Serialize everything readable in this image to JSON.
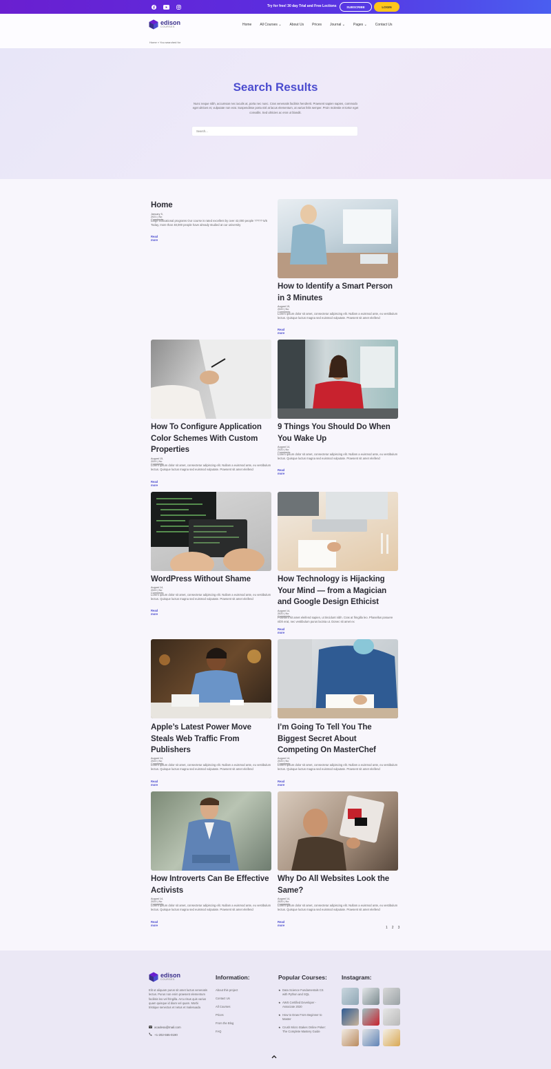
{
  "topbar": {
    "promo": "Try for free! 30 day Trial and Free Lections",
    "subscribe_label": "SUBSCRIBE",
    "login_label": "LOGIN",
    "social_icons": [
      "facebook-icon",
      "youtube-icon",
      "instagram-icon"
    ]
  },
  "header": {
    "logo_name": "edison",
    "logo_sub": "COURSES",
    "nav": [
      "Home",
      "All Courses",
      "About Us",
      "Prices",
      "Journal",
      "Pages",
      "Contact Us"
    ],
    "nav_dropdowns": [
      "All Courses",
      "Journal",
      "Pages"
    ],
    "breadcrumb": "Home » You searched for"
  },
  "hero": {
    "title": "Search Results",
    "text": "Nunc neque nibh, accumsan nec iaculis at, porta nec nunc. Cras venenatis facilisis hendrerit. Praesent sapien sapien, commodo eget ultrices et, vulputate non erat. Suspendisse porta nisl at lacus elementum, at varius felis semper. Proin molestie et tortor eget convallis. Sed ultricies ac eros ut blandit.",
    "search_placeholder": "Search..."
  },
  "posts": [
    {
      "title": "Home",
      "meta": "January 5, 2021 | No Comments",
      "excerpt": "Large educational programs Our course is rated excellent by over 42,000 people ????? 5/5 Today, more than 48,000 people have already studied at our university",
      "more": "Read more"
    },
    {
      "title": "How to Identify a Smart Person in 3 Minutes",
      "meta": "August 15, 2020 | No Comments",
      "excerpt": "Lorem ipsum dolor sit amet, consectetur adipiscing elit. Nullam a euismod ante, eu vestibulum lectus. Quisque luctus magna sed euismod vulputate. Praesent sit amet eleifend",
      "more": "Read more"
    },
    {
      "title": "How To Configure Application Color Schemes With Custom Properties",
      "meta": "August 15, 2020 | No Comments",
      "excerpt": "Lorem ipsum dolor sit amet, consectetur adipiscing elit. Nullam a euismod ante, eu vestibulum lectus. Quisque luctus magna sed euismod vulputate. Praesent sit amet eleifend",
      "more": "Read more"
    },
    {
      "title": "9 Things You Should Do When You Wake Up",
      "meta": "August 14, 2020 | No Comments",
      "excerpt": "Lorem ipsum dolor sit amet, consectetur adipiscing elit. Nullam a euismod ante, eu vestibulum lectus. Quisque luctus magna sed euismod vulputate. Praesent sit amet eleifend",
      "more": "Read more"
    },
    {
      "title": "WordPress Without Shame",
      "meta": "August 14, 2020 | No Comments",
      "excerpt": "Lorem ipsum dolor sit amet, consectetur adipiscing elit. Nullam a euismod ante, eu vestibulum lectus. Quisque luctus magna sed euismod vulputate. Praesent sit amet eleifend",
      "more": "Read more"
    },
    {
      "title": "How Technology is Hijacking Your Mind — from a Magician and Google Design Ethicist",
      "meta": "August 14, 2020 | No Comments",
      "excerpt": "Praesent sit amet eleifend sapien, ut tincidunt nibh. Cras at fringilla leo. Phasellus posuere nibh erat, nec vestibulum purus lacinia ut. Donec sit amet ex",
      "more": "Read more"
    },
    {
      "title": "Apple’s Latest Power Move Steals Web Traffic From Publishers",
      "meta": "August 14, 2020 | No Comments",
      "excerpt": "Lorem ipsum dolor sit amet, consectetur adipiscing elit. Nullam a euismod ante, eu vestibulum lectus. Quisque luctus magna sed euismod vulputate. Praesent sit amet eleifend",
      "more": "Read more"
    },
    {
      "title": "I’m Going To Tell You The Biggest Secret About Competing On MasterChef",
      "meta": "August 14, 2020 | No Comments",
      "excerpt": "Lorem ipsum dolor sit amet, consectetur adipiscing elit. Nullam a euismod ante, eu vestibulum lectus. Quisque luctus magna sed euismod vulputate. Praesent sit amet eleifend",
      "more": "Read more"
    },
    {
      "title": "How Introverts Can Be Effective Activists",
      "meta": "August 14, 2020 | No Comments",
      "excerpt": "Lorem ipsum dolor sit amet, consectetur adipiscing elit. Nullam a euismod ante, eu vestibulum lectus. Quisque luctus magna sed euismod vulputate. Praesent sit amet eleifend",
      "more": "Read more"
    },
    {
      "title": "Why Do All Websites Look the Same?",
      "meta": "August 14, 2020 | No Comments",
      "excerpt": "Lorem ipsum dolor sit amet, consectetur adipiscing elit. Nullam a euismod ante, eu vestibulum lectus. Quisque luctus magna sed euismod vulputate. Praesent sit amet eleifend",
      "more": "Read more"
    }
  ],
  "pagination": [
    "1",
    "2",
    "3"
  ],
  "footer": {
    "about": "Elit ut aliquam purus sit amet luctus venenatis lectus. Purus non enim praesent elementum facilisis leo vel fringilla. Arcu risus quis varius quam quisque id diam vel quam. Morbi tristique senectus et netus et malesuada",
    "email": "acadesa@mail.com",
    "phone": "+1-202-555-0190",
    "info_heading": "Information:",
    "info_links": [
      "About this project",
      "Contact Us",
      "All Courses",
      "Prices",
      "From the Blog",
      "FAQ"
    ],
    "courses_heading": "Popular Courses:",
    "courses": [
      "Data Science Fundamentals CS with Python and SQL",
      "AWS Certified Developer - Associate 2020",
      "How to Draw From Beginner to Master",
      "Crush Micro Stakes Online Poker: The Complete Mastery Guide"
    ],
    "instagram_heading": "Instagram:"
  },
  "colors": {
    "accent": "#4b4ccf",
    "button_yellow": "#ffc61a",
    "topbar_start": "#6a1fd0",
    "topbar_end": "#4a5ef0"
  }
}
